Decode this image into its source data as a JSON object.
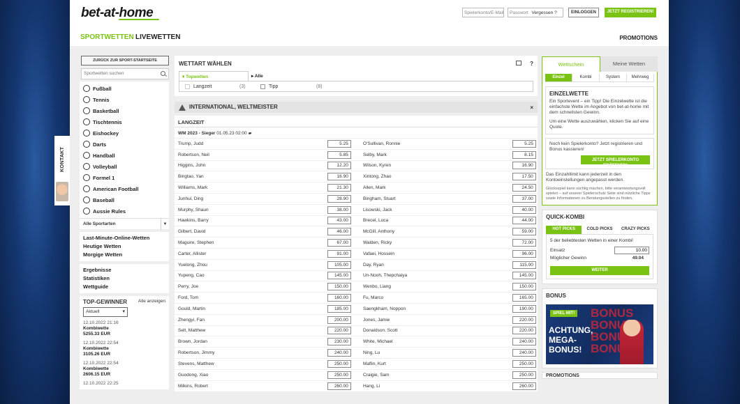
{
  "header": {
    "logo": "bet-at-home",
    "account_placeholder": "Spielerkonto/E-Mail",
    "password_placeholder": "Passwort",
    "forgot": "Vergessen ?",
    "login": "EINLOGGEN",
    "register": "JETZT REGISTRIEREN!",
    "nav_sport": "SPORTWETTEN",
    "nav_live": "LIVEWETTEN",
    "nav_promo": "PROMOTIONS"
  },
  "sidebar": {
    "back": "ZURÜCK ZUR SPORT-STARTSEITE",
    "search_placeholder": "Sportwetten suchen",
    "sports": [
      {
        "label": "Fußball",
        "icon": "football-icon"
      },
      {
        "label": "Tennis",
        "icon": "tennis-icon"
      },
      {
        "label": "Basketball",
        "icon": "basketball-icon"
      },
      {
        "label": "Tischtennis",
        "icon": "tabletennis-icon"
      },
      {
        "label": "Eishockey",
        "icon": "icehockey-icon"
      },
      {
        "label": "Darts",
        "icon": "darts-icon"
      },
      {
        "label": "Handball",
        "icon": "handball-icon"
      },
      {
        "label": "Volleyball",
        "icon": "volleyball-icon"
      },
      {
        "label": "Formel 1",
        "icon": "formula1-icon"
      },
      {
        "label": "American Football",
        "icon": "americanfootball-icon"
      },
      {
        "label": "Baseball",
        "icon": "baseball-icon"
      },
      {
        "label": "Aussie Rules",
        "icon": "aussierules-icon"
      }
    ],
    "all_sports": "Alle Sportarten",
    "links1": [
      "Last-Minute-Online-Wetten",
      "Heutige Wetten",
      "Morgige Wetten"
    ],
    "links2": [
      "Ergebnisse",
      "Statistiken",
      "Wettguide"
    ],
    "winners_title": "TOP-GEWINNER",
    "winners_all": "Alle anzeigen",
    "winners_select": "Aktuell",
    "winners": [
      {
        "date": "12.10.2022 21:16",
        "type": "Kombiwette",
        "amount": "5255.33",
        "cur": "EUR"
      },
      {
        "date": "12.10.2022 22:54",
        "type": "Kombiwette",
        "amount": "3105.26",
        "cur": "EUR"
      },
      {
        "date": "12.10.2022 22:54",
        "type": "Kombiwette",
        "amount": "2606.15",
        "cur": "EUR"
      },
      {
        "date": "12.10.2022 22:25",
        "type": "",
        "amount": "",
        "cur": ""
      }
    ],
    "kontakt": "KONTAKT"
  },
  "main": {
    "title": "WETTART WÄHLEN",
    "help": "?",
    "topwetten": "Topwetten",
    "alle": "Alle",
    "options": [
      {
        "label": "Langzeit",
        "count": "(3)"
      },
      {
        "label": "Tipp",
        "count": "(8)"
      }
    ],
    "section": "INTERNATIONAL, WELTMEISTER",
    "close": "×",
    "market": "LANGZEIT",
    "event_name": "WM 2023 - Sieger",
    "event_date": "01.05.23 02:00",
    "rows": [
      [
        "Trump, Judd",
        "5.25",
        "O'Sullivan, Ronnie",
        "5.25"
      ],
      [
        "Robertson, Neil",
        "5.85",
        "Selby, Mark",
        "8.15"
      ],
      [
        "Higgins, John",
        "12.20",
        "Wilson, Kyren",
        "16.90"
      ],
      [
        "Bingtao, Yan",
        "16.90",
        "Xintong, Zhao",
        "17.50"
      ],
      [
        "Williams, Mark",
        "21.30",
        "Allen, Mark",
        "24.50"
      ],
      [
        "Junhui, Ding",
        "28.90",
        "Bingham, Stuart",
        "37.00"
      ],
      [
        "Murphy, Shaun",
        "38.00",
        "Lisowski, Jack",
        "40.00"
      ],
      [
        "Hawkins, Barry",
        "43.00",
        "Brecel, Luca",
        "44.00"
      ],
      [
        "Gilbert, David",
        "46.00",
        "McGill, Anthony",
        "59.00"
      ],
      [
        "Maguire, Stephen",
        "67.00",
        "Walden, Ricky",
        "72.00"
      ],
      [
        "Carter, Allister",
        "91.00",
        "Vafaei, Hossein",
        "96.00"
      ],
      [
        "Yuelong, Zhou",
        "105.00",
        "Day, Ryan",
        "115.00"
      ],
      [
        "Yupeng, Cao",
        "145.00",
        "Un-Nooh, Thepchaiya",
        "145.00"
      ],
      [
        "Perry, Joe",
        "150.00",
        "Wenbo, Liang",
        "150.00"
      ],
      [
        "Ford, Tom",
        "160.00",
        "Fu, Marco",
        "165.00"
      ],
      [
        "Gould, Martin",
        "185.00",
        "Saengkham, Noppon",
        "190.00"
      ],
      [
        "Zhengyi, Fan",
        "200.00",
        "Jones, Jamie",
        "220.00"
      ],
      [
        "Selt, Matthew",
        "220.00",
        "Donaldson, Scott",
        "220.00"
      ],
      [
        "Brown, Jordan",
        "230.00",
        "White, Michael",
        "240.00"
      ],
      [
        "Robertson, Jimmy",
        "240.00",
        "Ning, Lu",
        "240.00"
      ],
      [
        "Stevens, Matthew",
        "250.00",
        "Maflin, Kurt",
        "250.00"
      ],
      [
        "Guodong, Xiao",
        "250.00",
        "Craigie, Sam",
        "250.00"
      ],
      [
        "Milkins, Robert",
        "260.00",
        "Hang, Li",
        "260.00"
      ]
    ]
  },
  "slip": {
    "tab_active": "Wettschein",
    "tab_other": "Meine Wetten",
    "subtabs": [
      "Einzel",
      "Kombi",
      "System",
      "Mehrweg"
    ],
    "einzel_title": "EINZELWETTE",
    "einzel_p1": "Ein Sportevent – ein Tipp! Die Einzelwette ist die einfachste Wette im Angebot von bet-at-home mit dem schnellsten Gewinn.",
    "einzel_p2": "Um eine Wette auszuwählen, klicken Sie auf eine Quote.",
    "konto_text": "Noch kein Spielerkonto? Jetzt registrieren und Bonus kassieren!",
    "konto_btn": "JETZT SPIELERKONTO ERÖFFNEN!",
    "limit": "Das Einzahllimit kann jederzeit in den Kontoeinstellungen angepasst werden.",
    "warning": "Glücksspiel kann süchtig machen, bitte verantwortungsvoll spielen – auf unserer Spielerschutz Seite sind nützliche Tipps sowie Informationen zu Beratungsstellen zu finden."
  },
  "quick": {
    "title": "QUICK-KOMBI",
    "tabs": [
      "HOT PICKS",
      "COLD PICKS",
      "CRAZY PICKS"
    ],
    "line": "5 der beliebtesten Wetten in einer Kombi!",
    "einsatz_label": "Einsatz",
    "einsatz_value": "10.00",
    "gewinn_label": "Möglicher Gewinn",
    "gewinn_value": "49.04",
    "button": "WEITER"
  },
  "bonus": {
    "title": "BONUS",
    "play": "SPIEL MIT!",
    "line1": "ACHTUNG,",
    "line2": "MEGA-",
    "line3": "BONUS!",
    "ghost": "BONUS",
    "next": "PROMOTIONS"
  }
}
